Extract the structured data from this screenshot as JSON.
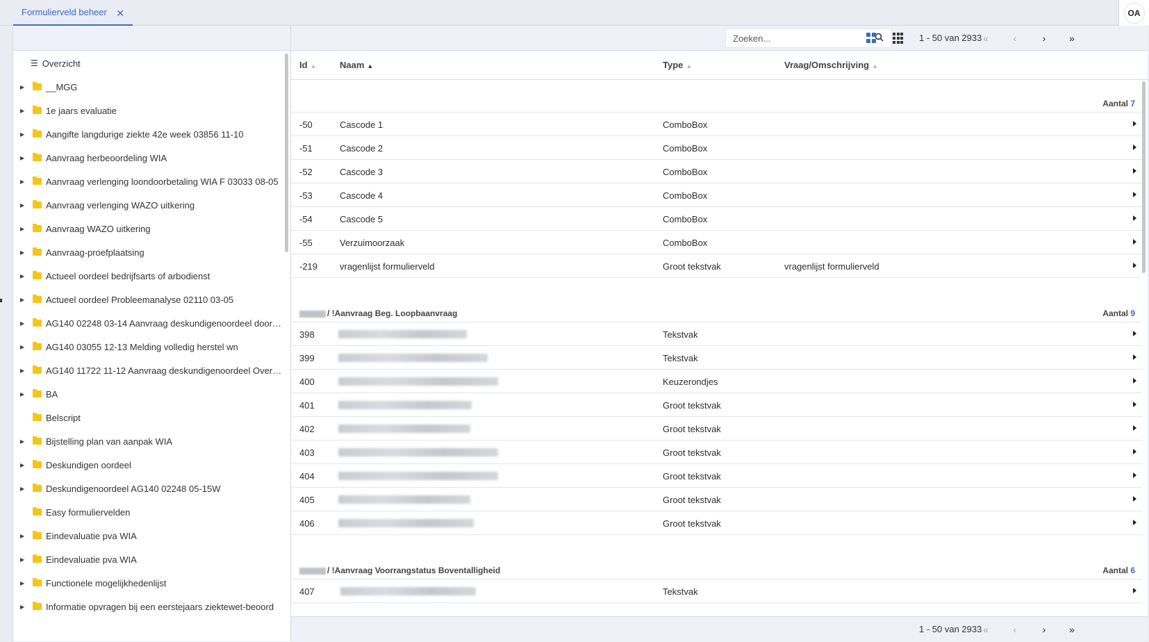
{
  "tabs": [
    {
      "label": "Formulierveld beheer",
      "close_icon": "close-icon"
    }
  ],
  "user": {
    "initials": "OA"
  },
  "tree": {
    "overview_label": "Overzicht",
    "items": [
      {
        "label": "__MGG",
        "expandable": true
      },
      {
        "label": "1e jaars evaluatie",
        "expandable": true
      },
      {
        "label": "Aangifte langdurige ziekte 42e week 03856 11-10",
        "expandable": true
      },
      {
        "label": "Aanvraag herbeoordeling WIA",
        "expandable": true
      },
      {
        "label": "Aanvraag verlenging loondoorbetaling WIA F 03033 08-05",
        "expandable": true
      },
      {
        "label": "Aanvraag verlenging WAZO uitkering",
        "expandable": true
      },
      {
        "label": "Aanvraag WAZO uitkering",
        "expandable": true
      },
      {
        "label": "Aanvraag-proefplaatsing",
        "expandable": true
      },
      {
        "label": "Actueel oordeel bedrijfsarts of arbodienst",
        "expandable": true
      },
      {
        "label": "Actueel oordeel Probleemanalyse 02110 03-05",
        "expandable": true
      },
      {
        "label": "AG140 02248 03-14 Aanvraag deskundigenoordeel door ...",
        "expandable": true
      },
      {
        "label": "AG140 03055 12-13 Melding volledig herstel wn",
        "expandable": true
      },
      {
        "label": "AG140 11722 11-12 Aanvraag deskundigenoordeel Overh...",
        "expandable": true
      },
      {
        "label": "BA",
        "expandable": true
      },
      {
        "label": "Belscript",
        "expandable": false
      },
      {
        "label": "Bijstelling plan van aanpak WIA",
        "expandable": true
      },
      {
        "label": "Deskundigen oordeel",
        "expandable": true
      },
      {
        "label": "Deskundigenoordeel AG140 02248 05-15W",
        "expandable": true
      },
      {
        "label": "Easy formuliervelden",
        "expandable": false
      },
      {
        "label": "Eindevaluatie pva WIA",
        "expandable": true
      },
      {
        "label": "Eindevaluatie pva WIA",
        "expandable": true
      },
      {
        "label": "Functionele mogelijkhedenlijst",
        "expandable": true
      },
      {
        "label": "Informatie opvragen bij een eerstejaars ziektewet-beoord",
        "expandable": true
      }
    ]
  },
  "toolbar": {
    "search_placeholder": "Zoeken...",
    "pager_text": "1 - 50 van 2933"
  },
  "columns": {
    "id": "Id",
    "naam": "Naam",
    "type": "Type",
    "vraag": "Vraag/Omschrijving"
  },
  "groups": [
    {
      "name": "",
      "count_label": "Aantal",
      "count": "7",
      "rows": [
        {
          "id": "-50",
          "naam": "Cascode 1",
          "type": "ComboBox",
          "vraag": ""
        },
        {
          "id": "-51",
          "naam": "Cascode 2",
          "type": "ComboBox",
          "vraag": ""
        },
        {
          "id": "-52",
          "naam": "Cascode 3",
          "type": "ComboBox",
          "vraag": ""
        },
        {
          "id": "-53",
          "naam": "Cascode 4",
          "type": "ComboBox",
          "vraag": ""
        },
        {
          "id": "-54",
          "naam": "Cascode 5",
          "type": "ComboBox",
          "vraag": ""
        },
        {
          "id": "-55",
          "naam": "Verzuimoorzaak",
          "type": "ComboBox",
          "vraag": ""
        },
        {
          "id": "-219",
          "naam": "vragenlijst formulierveld",
          "type": "Groot tekstvak",
          "vraag": "vragenlijst formulierveld"
        }
      ]
    },
    {
      "name": "/ !Aanvraag Beg. Loopbaanvraag",
      "count_label": "Aantal",
      "count": "9",
      "rows": [
        {
          "id": "398",
          "naam": "",
          "type": "Tekstvak",
          "vraag": ""
        },
        {
          "id": "399",
          "naam": "",
          "type": "Tekstvak",
          "vraag": ""
        },
        {
          "id": "400",
          "naam": "",
          "type": "Keuzerondjes",
          "vraag": ""
        },
        {
          "id": "401",
          "naam": "",
          "type": "Groot tekstvak",
          "vraag": ""
        },
        {
          "id": "402",
          "naam": "",
          "type": "Groot tekstvak",
          "vraag": ""
        },
        {
          "id": "403",
          "naam": "",
          "type": "Groot tekstvak",
          "vraag": ""
        },
        {
          "id": "404",
          "naam": "",
          "type": "Groot tekstvak",
          "vraag": ""
        },
        {
          "id": "405",
          "naam": "",
          "type": "Groot tekstvak",
          "vraag": ""
        },
        {
          "id": "406",
          "naam": "",
          "type": "Groot tekstvak",
          "vraag": ""
        }
      ]
    },
    {
      "name": "/ !Aanvraag Voorrangstatus Boventalligheid",
      "count_label": "Aantal",
      "count": "6",
      "rows": [
        {
          "id": "407",
          "naam": "",
          "type": "Tekstvak",
          "vraag": ""
        }
      ]
    }
  ],
  "footer": {
    "pager_text": "1 - 50 van 2933"
  },
  "colors": {
    "accent": "#3c6cc4",
    "folder": "#f5c518",
    "panel_bg": "#eef1f7"
  }
}
